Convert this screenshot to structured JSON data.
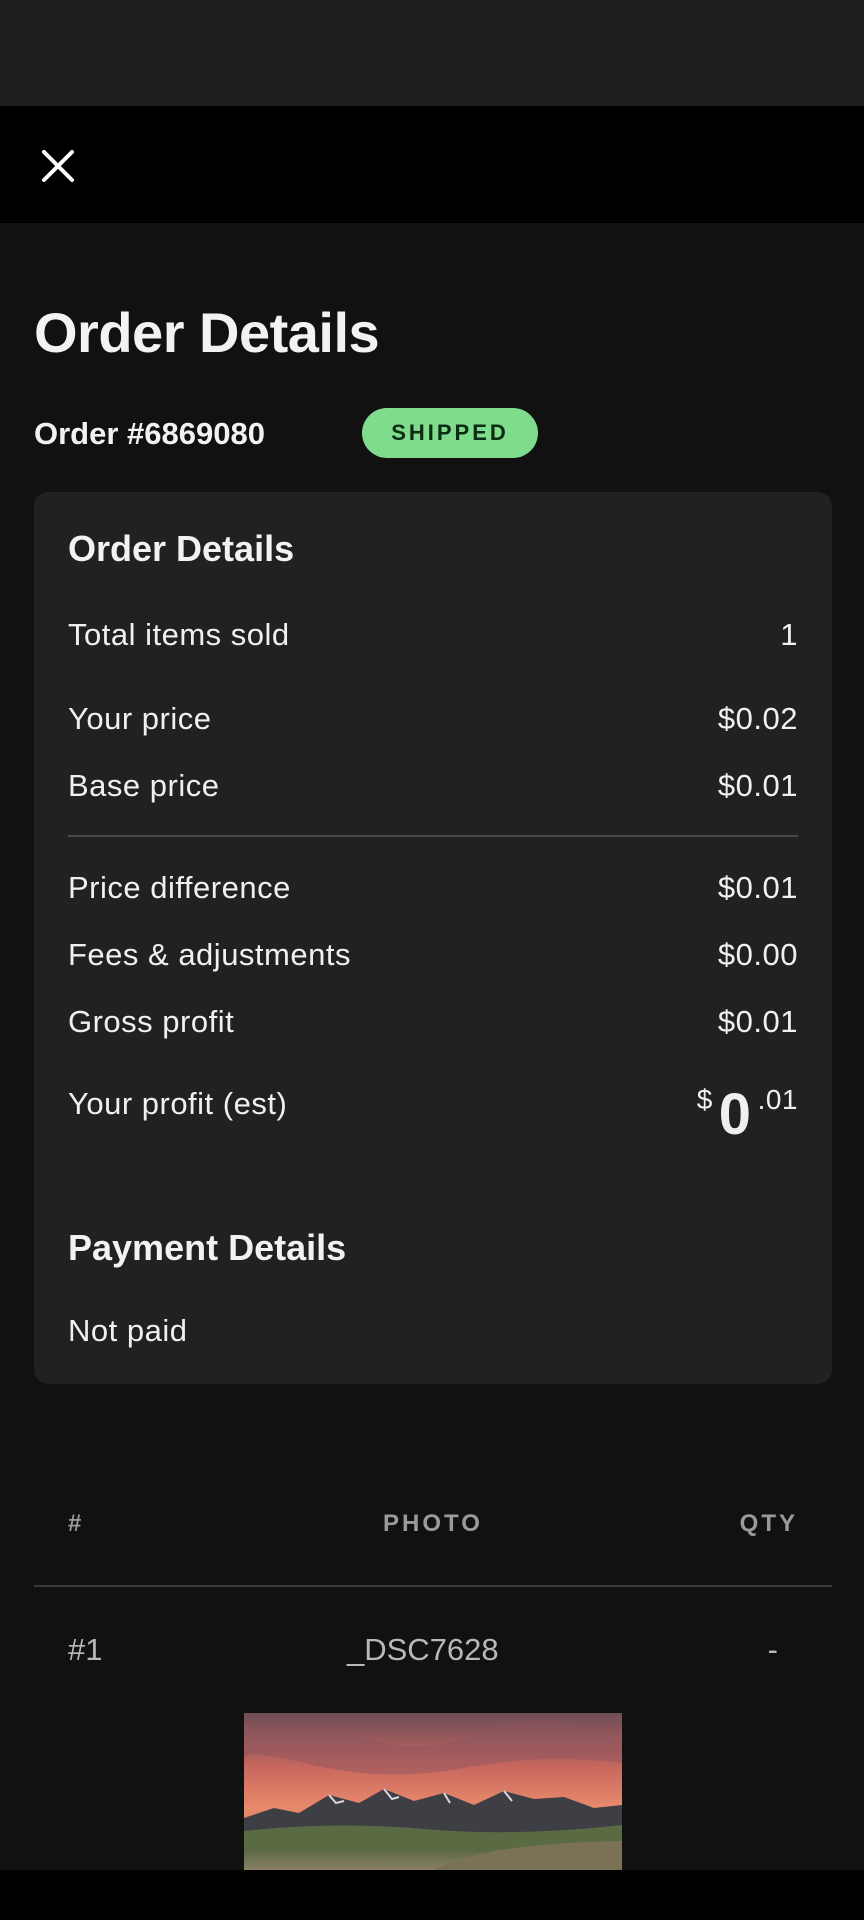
{
  "page": {
    "title": "Order Details"
  },
  "order": {
    "number_label": "Order #6869080",
    "status": "SHIPPED"
  },
  "details_card": {
    "title": "Order Details",
    "rows": [
      {
        "label": "Total items sold",
        "value": "1"
      },
      {
        "label": "Your price",
        "value": "$0.02"
      },
      {
        "label": "Base price",
        "value": "$0.01"
      },
      {
        "label": "Price difference",
        "value": "$0.01"
      },
      {
        "label": "Fees & adjustments",
        "value": "$0.00"
      },
      {
        "label": "Gross profit",
        "value": "$0.01"
      }
    ],
    "profit": {
      "label": "Your profit (est)",
      "currency": "$",
      "whole": "0",
      "cents": ".01"
    },
    "payment_title": "Payment Details",
    "payment_status": "Not paid"
  },
  "items_table": {
    "columns": [
      "#",
      "PHOTO",
      "QTY"
    ],
    "rows": [
      {
        "index": "#1",
        "photo": "_DSC7628",
        "qty": "-"
      }
    ]
  },
  "colors": {
    "status_badge": "#7fdc8c",
    "card_bg": "#212122",
    "page_bg": "#111112"
  },
  "icons": {
    "close": "close-icon"
  }
}
